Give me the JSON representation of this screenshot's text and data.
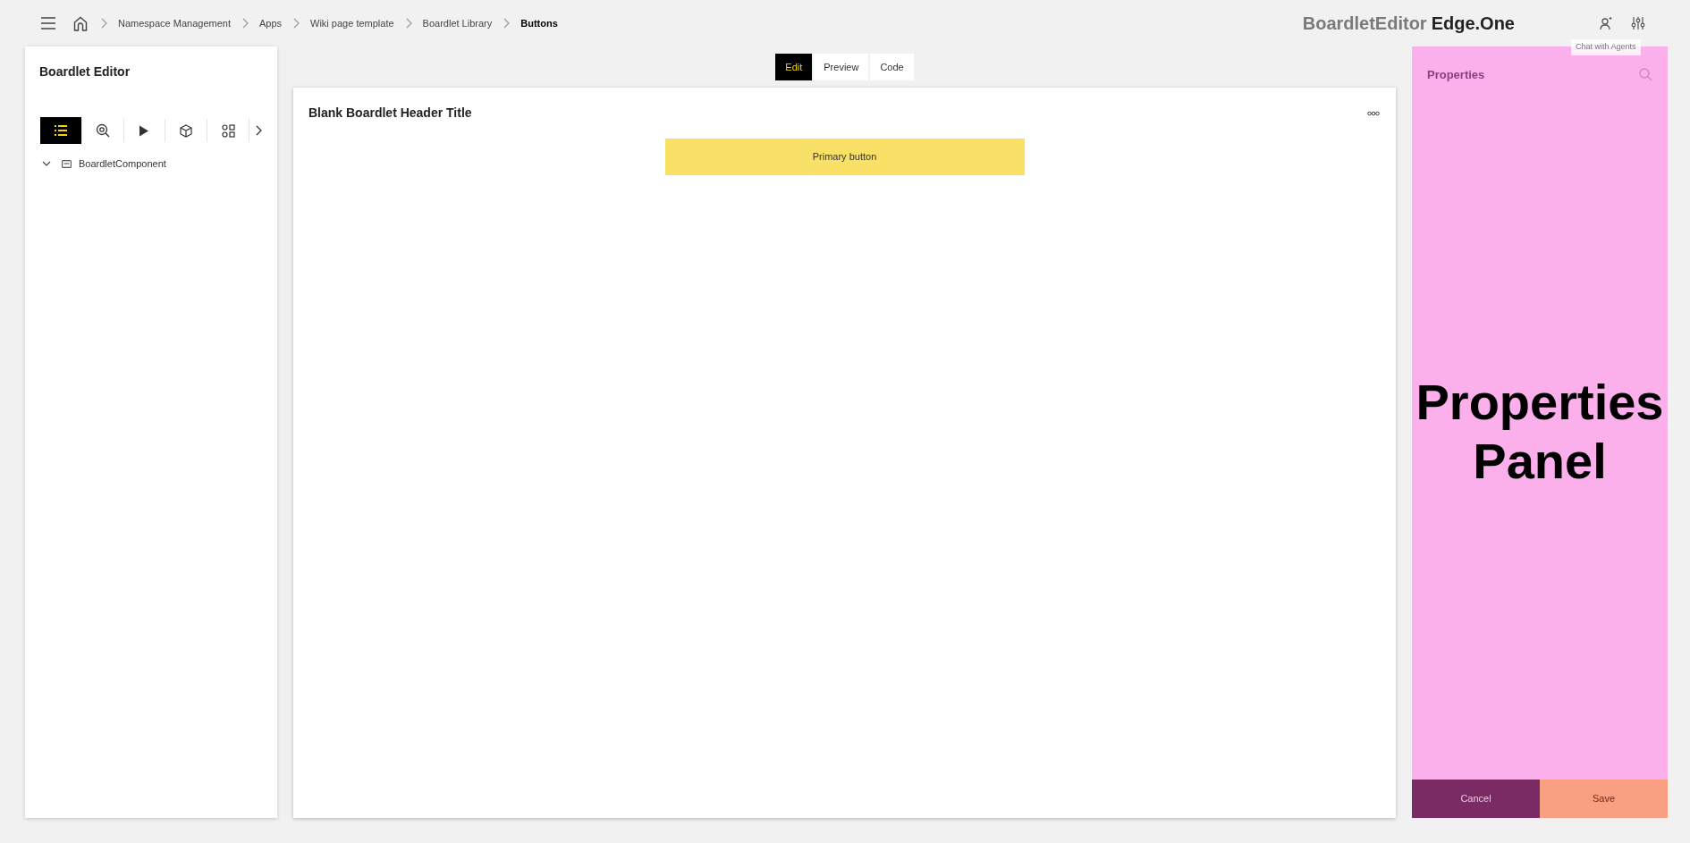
{
  "breadcrumbs": [
    {
      "label": "Namespace Management",
      "current": false
    },
    {
      "label": "Apps",
      "current": false
    },
    {
      "label": "Wiki page template",
      "current": false
    },
    {
      "label": "Boardlet Library",
      "current": false
    },
    {
      "label": "Buttons",
      "current": true
    }
  ],
  "brand": {
    "app": "BoardletEditor",
    "product": "Edge.One"
  },
  "tooltip": "Chat with Agents",
  "left_panel": {
    "title": "Boardlet Editor",
    "toolbar": [
      {
        "kind": "list",
        "selected": true
      },
      {
        "kind": "inspect",
        "selected": false
      },
      {
        "kind": "play",
        "selected": false
      },
      {
        "kind": "cube",
        "selected": false
      },
      {
        "kind": "grid",
        "selected": false
      }
    ],
    "tree": [
      {
        "label": "BoardletComponent",
        "expanded": true
      }
    ]
  },
  "view_tabs": [
    {
      "label": "Edit",
      "selected": true
    },
    {
      "label": "Preview",
      "selected": false
    },
    {
      "label": "Code",
      "selected": false
    }
  ],
  "canvas": {
    "title": "Blank Boardlet Header Title",
    "button": "Primary button"
  },
  "properties_panel": {
    "title": "Properties",
    "overlay": "Properties Panel",
    "buttons": [
      {
        "label": "Cancel",
        "kind": "secondary"
      },
      {
        "label": "Save",
        "kind": "primary"
      }
    ]
  }
}
